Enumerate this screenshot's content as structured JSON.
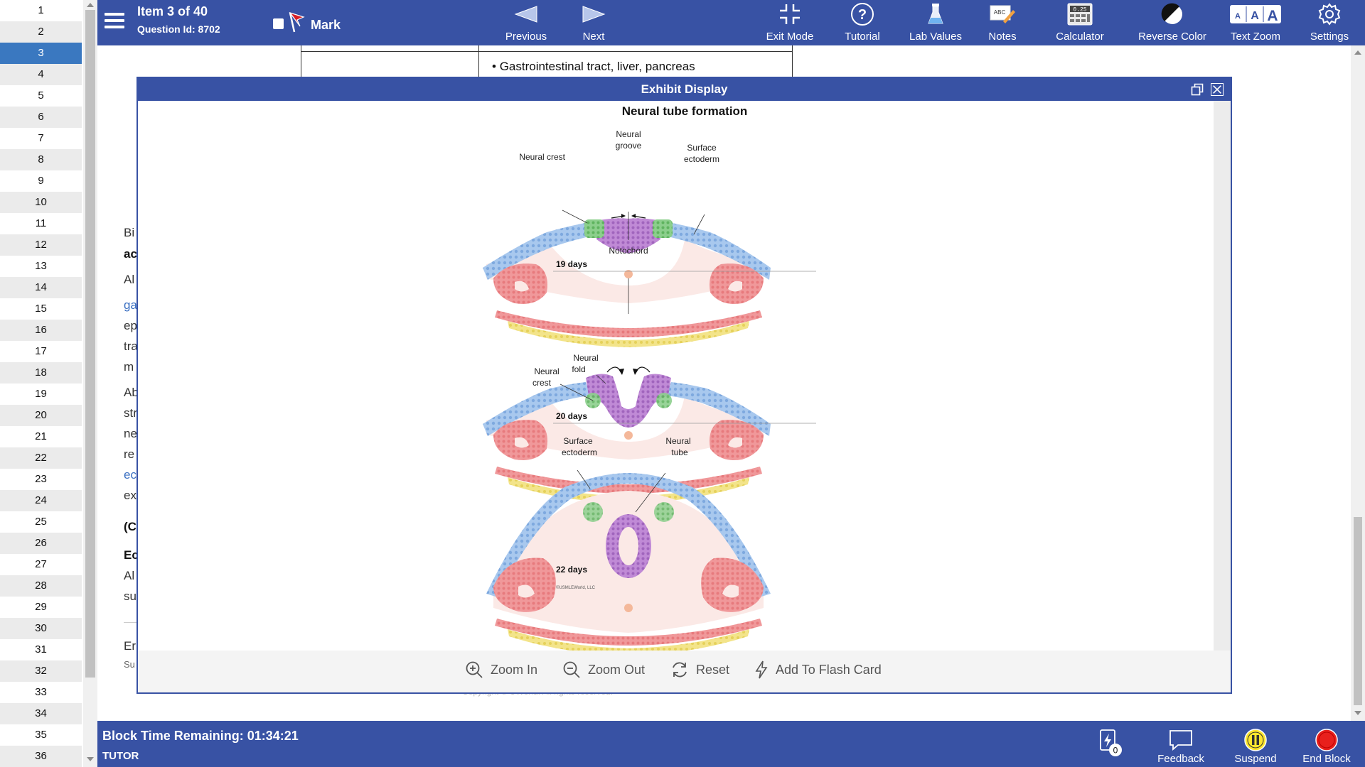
{
  "question_nav": {
    "items": [
      "1",
      "2",
      "3",
      "4",
      "5",
      "6",
      "7",
      "8",
      "9",
      "10",
      "11",
      "12",
      "13",
      "14",
      "15",
      "16",
      "17",
      "18",
      "19",
      "20",
      "21",
      "22",
      "23",
      "24",
      "25",
      "26",
      "27",
      "28",
      "29",
      "30",
      "31",
      "32",
      "33",
      "34",
      "35",
      "36"
    ],
    "active_index": 2
  },
  "topbar": {
    "item_label": "Item 3 of 40",
    "question_id": "Question Id: 8702",
    "mark_label": "Mark",
    "previous_label": "Previous",
    "next_label": "Next",
    "exit_mode_label": "Exit Mode",
    "tutorial_label": "Tutorial",
    "lab_values_label": "Lab Values",
    "notes_label": "Notes",
    "calculator_label": "Calculator",
    "calculator_display": "0.25",
    "reverse_color_label": "Reverse Color",
    "text_zoom_label": "Text Zoom",
    "settings_label": "Settings",
    "notes_icon_text": "ABC"
  },
  "background": {
    "table_cell": "Gastrointestinal tract, liver, pancreas",
    "fragments": [
      "Bi",
      "ac",
      "Al",
      "ga",
      "ep",
      "tra",
      "m",
      "Ab",
      "str",
      "ne",
      "re",
      "ec",
      "ex",
      "(C",
      "Ec",
      "Al",
      "su",
      "Er",
      "Su"
    ],
    "copyright": "Copyright © UWorld. All rights reserved."
  },
  "exhibit": {
    "title": "Exhibit Display",
    "figure_title": "Neural tube formation",
    "labels": {
      "neural_groove": "Neural groove",
      "neural_crest_1": "Neural crest",
      "surface_ectoderm_1": "Surface ectoderm",
      "notochord": "Notochord",
      "days_19": "19 days",
      "neural_fold": "Neural fold",
      "neural_crest_2": "Neural crest",
      "days_20": "20 days",
      "surface_ectoderm_2": "Surface ectoderm",
      "neural_tube": "Neural tube",
      "days_22": "22 days",
      "credit": "©USMLEWorld, LLC"
    },
    "zoom_in_label": "Zoom In",
    "zoom_out_label": "Zoom Out",
    "reset_label": "Reset",
    "flash_card_label": "Add To Flash Card"
  },
  "bottombar": {
    "time_remaining": "Block Time Remaining: 01:34:21",
    "mode": "TUTOR",
    "flash_count": "0",
    "feedback_label": "Feedback",
    "suspend_label": "Suspend",
    "end_block_label": "End Block"
  },
  "colors": {
    "toolbar": "#3852a4",
    "active_item": "#3a78c0",
    "ectoderm": "#a8c8ee",
    "neural_plate": "#c08ad6",
    "neural_crest": "#8ccf8c",
    "somite": "#f0989a",
    "endoderm": "#f3e48a",
    "mesenchyme": "#fbe9e6"
  }
}
